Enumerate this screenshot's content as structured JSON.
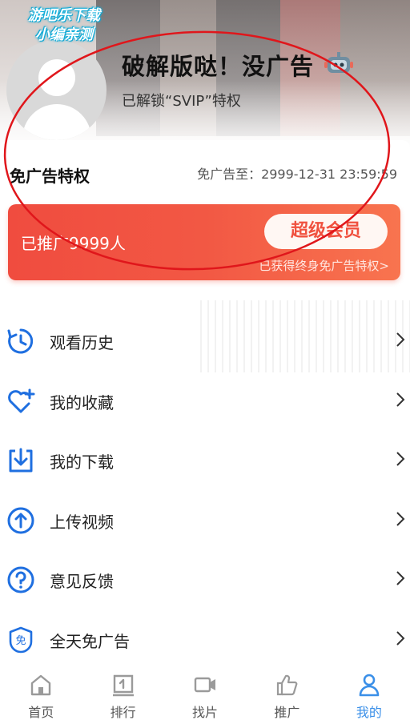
{
  "watermark": {
    "line1": "游吧乐下载",
    "line2": "小编亲测"
  },
  "profile": {
    "name": "破解版哒！没广告",
    "subtitle": "已解锁“SVIP”特权"
  },
  "privilege": {
    "title": "免广告特权",
    "expiry": "免广告至：2999-12-31 23:59:59"
  },
  "promo": {
    "count_text": "已推广9999人",
    "button_label": "超级会员",
    "note": "已获得终身免广告特权>"
  },
  "menu": {
    "items": [
      {
        "label": "观看历史",
        "icon": "history-icon"
      },
      {
        "label": "我的收藏",
        "icon": "heart-plus-icon"
      },
      {
        "label": "我的下载",
        "icon": "download-icon"
      },
      {
        "label": "上传视频",
        "icon": "upload-icon"
      },
      {
        "label": "意见反馈",
        "icon": "question-icon"
      },
      {
        "label": "全天免广告",
        "icon": "ad-free-icon"
      }
    ]
  },
  "nav": {
    "items": [
      {
        "label": "首页",
        "icon": "home-icon",
        "active": false
      },
      {
        "label": "排行",
        "icon": "ranking-icon",
        "active": false
      },
      {
        "label": "找片",
        "icon": "video-icon",
        "active": false
      },
      {
        "label": "推广",
        "icon": "thumbs-up-icon",
        "active": false
      },
      {
        "label": "我的",
        "icon": "person-icon",
        "active": true
      }
    ]
  },
  "colors": {
    "accent": "#3a8fe8",
    "promo_red": "#f04c3f",
    "icon_blue": "#1f6fe0",
    "annotation_red": "#e0161b"
  }
}
